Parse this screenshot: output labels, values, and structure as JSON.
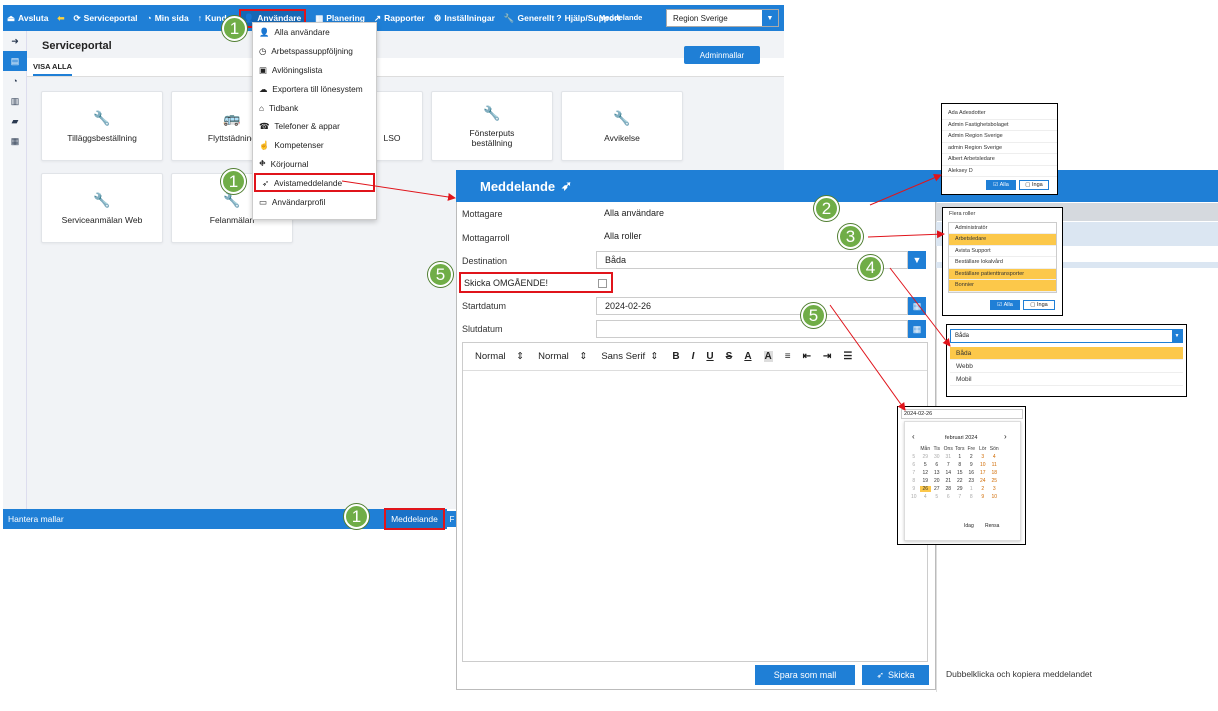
{
  "topbar": {
    "items": [
      {
        "icon": "exit-icon",
        "label": "Avsluta"
      },
      {
        "icon": "back-icon",
        "label": ""
      },
      {
        "icon": "refresh-icon",
        "label": "Serviceportal"
      },
      {
        "icon": "dashboard-icon",
        "label": "Min sida"
      },
      {
        "icon": "arrow-up-icon",
        "label": "Kunder"
      },
      {
        "icon": "user-icon",
        "label": "Användare"
      },
      {
        "icon": "calendar-icon",
        "label": "Planering"
      },
      {
        "icon": "chart-icon",
        "label": "Rapporter"
      },
      {
        "icon": "gears-icon",
        "label": "Inställningar"
      },
      {
        "icon": "wrench-icon",
        "label": "Generellt"
      },
      {
        "icon": "help-icon",
        "label": "Hjälp/Support"
      }
    ],
    "overlay_text": "Meddelande",
    "region": "Region Sverige"
  },
  "page": {
    "title": "Serviceportal",
    "tab": "VISA ALLA",
    "admin_button": "Adminmallar"
  },
  "cards": [
    {
      "icon": "wrench-icon",
      "label": "Tilläggsbeställning"
    },
    {
      "icon": "bus-icon",
      "label": "Flyttstädning"
    },
    {
      "icon": "wrench-icon",
      "label": "LSO"
    },
    {
      "icon": "wrench-icon",
      "label": "Fönsterputs beställning"
    },
    {
      "icon": "wrench-icon",
      "label": "Avvikelse"
    },
    {
      "icon": "wrench-icon",
      "label": "Serviceanmälan Web"
    },
    {
      "icon": "wrench-icon",
      "label": "Felanmälan"
    }
  ],
  "dropdown": {
    "items": [
      {
        "icon": "user-icon",
        "label": "Alla användare"
      },
      {
        "icon": "clock-icon",
        "label": "Arbetspassuppföljning"
      },
      {
        "icon": "money-icon",
        "label": "Avlöningslista"
      },
      {
        "icon": "cloud-icon",
        "label": "Exportera till lönesystem"
      },
      {
        "icon": "bank-icon",
        "label": "Tidbank"
      },
      {
        "icon": "phone-icon",
        "label": "Telefoner & appar"
      },
      {
        "icon": "thumb-icon",
        "label": "Kompetenser"
      },
      {
        "icon": "road-icon",
        "label": "Körjournal"
      },
      {
        "icon": "send-icon",
        "label": "Avistameddelande"
      },
      {
        "icon": "id-card-icon",
        "label": "Användarprofil"
      }
    ]
  },
  "bottom": {
    "left": "Hantera mallar",
    "meddelande": "Meddelande",
    "cut": "F"
  },
  "modal": {
    "title": "Meddelande",
    "mottagare_label": "Mottagare",
    "mottagare_value": "Alla användare",
    "mottagarroll_label": "Mottagarroll",
    "mottagarroll_value": "Alla roller",
    "destination_label": "Destination",
    "destination_value": "Båda",
    "skicka_label": "Skicka OMGÅENDE!",
    "start_label": "Startdatum",
    "start_value": "2024-02-26",
    "slut_label": "Slutdatum",
    "toolbar": {
      "normal1": "Normal",
      "normal2": "Normal",
      "font": "Sans Serif",
      "bold": "B",
      "italic": "I",
      "underline": "U",
      "strike": "S"
    },
    "save_template": "Spara som mall",
    "send": "Skicka",
    "hint": "Dubbelklicka och kopiera meddelandet"
  },
  "popup_users": {
    "items": [
      "Ada Adesdotter",
      "Admin Fastighetsbolaget",
      "Admin Region Sverige",
      "admin Region Sverige",
      "Albert Arbetsledare",
      "Aleksey D"
    ],
    "all": "Alla",
    "none": "Inga"
  },
  "popup_roles": {
    "header": "Flera roller",
    "items": [
      "Administratör",
      "Arbetsledare",
      "Avista Support",
      "Beställare lokalvård",
      "Beställare patienttransporter",
      "Bonnier"
    ],
    "all": "Alla",
    "none": "Inga"
  },
  "popup_destination": {
    "selected": "Båda",
    "options": [
      "Båda",
      "Webb",
      "Mobil"
    ]
  },
  "popup_calendar": {
    "input": "2024-02-26",
    "month": "februari 2024",
    "weekdays": [
      "Mån",
      "Tis",
      "Ons",
      "Tors",
      "Fre",
      "Lör",
      "Sön"
    ],
    "weeks": [
      [
        "5",
        "29",
        "30",
        "31",
        "1",
        "2",
        "3",
        "4"
      ],
      [
        "6",
        "5",
        "6",
        "7",
        "8",
        "9",
        "10",
        "11"
      ],
      [
        "7",
        "12",
        "13",
        "14",
        "15",
        "16",
        "17",
        "18"
      ],
      [
        "8",
        "19",
        "20",
        "21",
        "22",
        "23",
        "24",
        "25"
      ],
      [
        "9",
        "26",
        "27",
        "28",
        "29",
        "1",
        "2",
        "3"
      ],
      [
        "10",
        "4",
        "5",
        "6",
        "7",
        "8",
        "9",
        "10"
      ]
    ],
    "today": "Idag",
    "clear": "Rensa"
  },
  "callouts": [
    "1",
    "1",
    "1",
    "2",
    "3",
    "4",
    "5",
    "5"
  ],
  "colors": {
    "primary": "#1f7fd6",
    "highlight": "#e0141b",
    "callout": "#70ad47",
    "selected": "#fcc84a"
  }
}
